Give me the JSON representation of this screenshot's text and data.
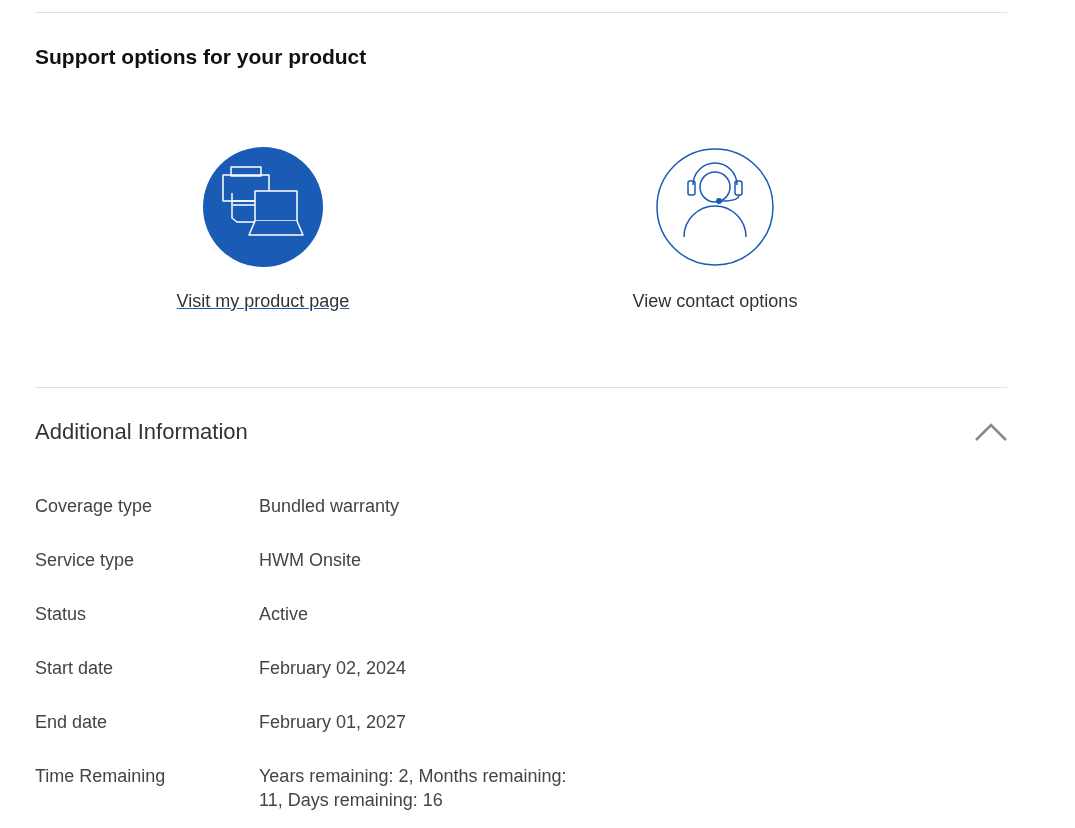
{
  "support": {
    "title": "Support options for your product",
    "options": [
      {
        "kind": "product",
        "label": "Visit my product page",
        "link": true
      },
      {
        "kind": "contact",
        "label": "View contact options",
        "link": false
      }
    ]
  },
  "additional_info": {
    "title": "Additional Information",
    "expanded": true,
    "rows": [
      {
        "label": "Coverage type",
        "value": "Bundled warranty"
      },
      {
        "label": "Service type",
        "value": "HWM Onsite"
      },
      {
        "label": "Status",
        "value": "Active"
      },
      {
        "label": "Start date",
        "value": "February 02, 2024"
      },
      {
        "label": "End date",
        "value": "February 01, 2027"
      },
      {
        "label": "Time Remaining",
        "value": "Years remaining: 2, Months remaining: 11, Days remaining: 16"
      }
    ]
  }
}
